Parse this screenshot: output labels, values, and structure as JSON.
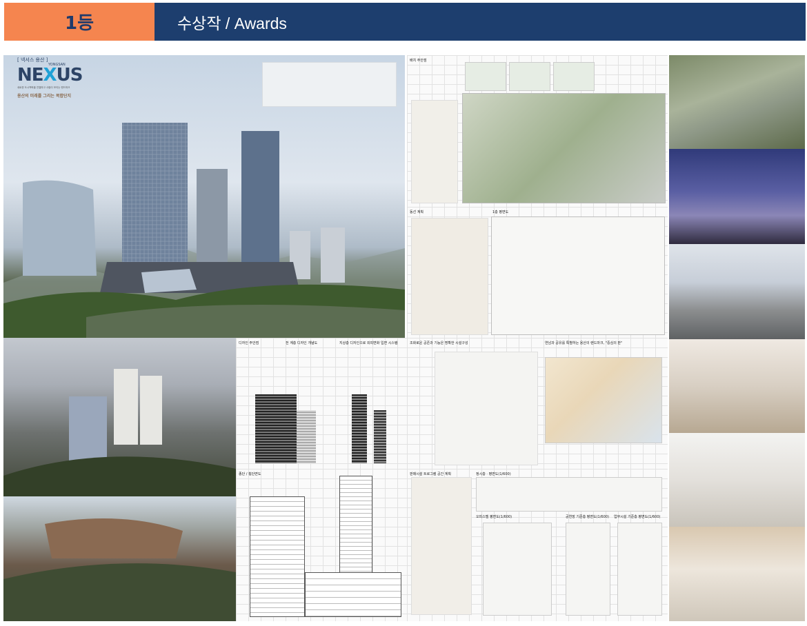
{
  "header": {
    "rank_label": "1등",
    "title": "수상작 / Awards",
    "rank_color": "#f5854f",
    "title_bar_color": "#1d3e6e"
  },
  "hero": {
    "logo_small": "[ 넥서스 용산 ]",
    "logo_main": "NE",
    "logo_x": "X",
    "logo_us": "US",
    "logo_yongsan": "YONGSAN",
    "tagline": "용산의 미래를 그리는 복합단지",
    "subtitle": "새로운 도시맥락을 연결하고 사람이 모이는 랜드마크"
  },
  "boards": {
    "plan1_title": "배치 주안점",
    "plan2_title": "동선 계획",
    "plan2_subtitle": "1층 평면도",
    "facade_title": "디자인 주안점",
    "facade_sub1": "전 계층 디자인 개념도",
    "facade_sub2": "지상층 디자인으로 외피변화 입면 시스템",
    "section_title": "종단 / 횡단면도",
    "diagram_title": "조화로운 공존과 기능은 명확한 시설구성",
    "diagram_sub": "연남과 공유를 특별하는 용산의 랜드마크, \"중심의 판\"",
    "floors_title": "판매시설 트로그램 공간 계획",
    "floors_sub1": "정시층 · 평면도(1/600)",
    "floors_sub2": "오피스텔 평면도(1/600)",
    "floors_sub3": "공연장 기준층 평면도(1/600)",
    "floors_sub4": "업무시설 기준층 평면도(1/600)"
  }
}
